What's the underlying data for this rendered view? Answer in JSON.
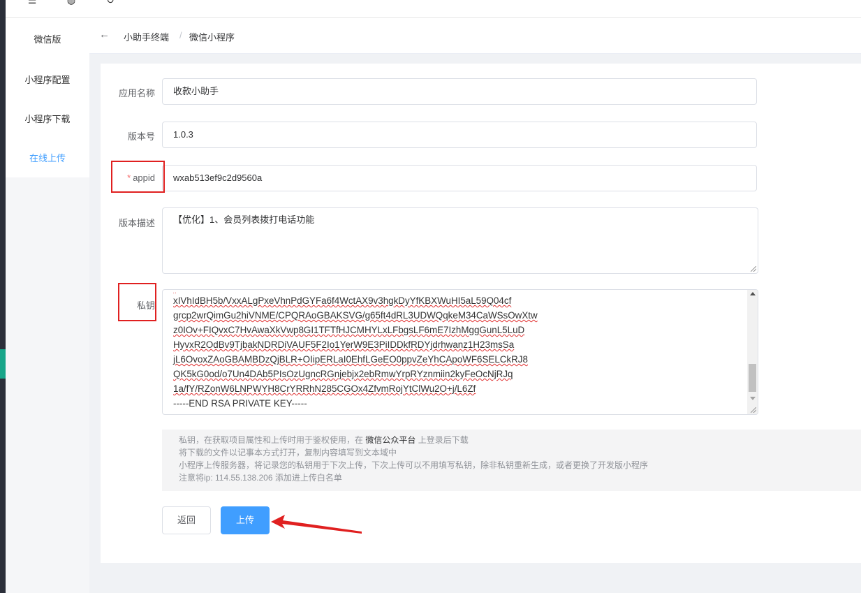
{
  "sidebar": {
    "items": [
      {
        "label": "微信版"
      },
      {
        "label": "小程序配置"
      },
      {
        "label": "小程序下载"
      },
      {
        "label": "在线上传"
      }
    ]
  },
  "breadcrumb": {
    "parent": "小助手终端",
    "separator": "/",
    "current": "微信小程序"
  },
  "form": {
    "app_name_label": "应用名称",
    "app_name_value": "收款小助手",
    "version_label": "版本号",
    "version_value": "1.0.3",
    "appid_required_mark": "*",
    "appid_label": "appid",
    "appid_value": "wxab513ef9c2d9560a",
    "desc_label": "版本描述",
    "desc_value": "【优化】1、会员列表拨打电话功能",
    "key_label": "私钥",
    "key_lines": [
      "xIVhIdBH5b/VxxALgPxeVhnPdGYFa6f4WctAX9v3hgkDyYfKBXWuHI5aL59Q04cf",
      "grcp2wrQimGu2hiVNME/CPQRAoGBAKSVG/g65ft4dRL3UDWQqkeM34CaWSsOwXtw",
      "z0IOv+FIQvxC7HvAwaXkVwp8GI1TFTfHJCMHYLxLFbgsLF6mE7IzhMggGunL5LuD",
      "HyvxR2OdBv9TjbakNDRDiVAUF5F2Io1YerW9E3PiIDDkfRDYjdrhwanz1H23msSa",
      "jL6OvoxZAoGBAMBDzQjBLR+OIipERLaI0EhfLGeEO0ppvZeYhCApoWF6SELCkRJ8",
      "QK5kG0od/o7Un4DAb5PIsOzUgncRGnjebjx2ebRmwYrpRYznmiin2kyFeOcNjRJq",
      "1a/fY/RZonW6LNPWYH8CrYRRhN285CGOx4ZfvmRojYtClWu2O+j/L6Zf",
      "-----END RSA PRIVATE KEY-----"
    ]
  },
  "tip": {
    "line1_prefix": "私钥，在获取项目属性和上传时用于鉴权使用，在",
    "line1_link": "微信公众平台",
    "line1_suffix": "上登录后下载",
    "line2": "将下载的文件以记事本方式打开，复制内容填写到文本域中",
    "line3": "小程序上传服务器，将记录您的私钥用于下次上传，下次上传可以不用填写私钥，除非私钥重新生成，或者更换了开发版小程序",
    "line4": "注意将ip: 114.55.138.206 添加进上传白名单"
  },
  "buttons": {
    "back_label": "返回",
    "upload_label": "上传"
  },
  "colors": {
    "primary": "#409eff",
    "annotation_red": "#e02020",
    "required": "#f56c6c"
  }
}
